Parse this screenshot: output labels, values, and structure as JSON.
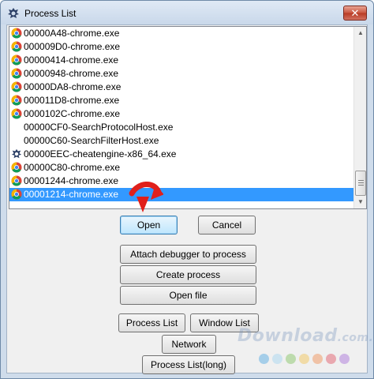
{
  "window": {
    "title": "Process List",
    "close_glyph": "✕",
    "app_icon": "cheatengine-icon"
  },
  "processes": [
    {
      "label": "00000A48-chrome.exe",
      "icon": "chrome-icon"
    },
    {
      "label": "000009D0-chrome.exe",
      "icon": "chrome-icon"
    },
    {
      "label": "00000414-chrome.exe",
      "icon": "chrome-icon"
    },
    {
      "label": "00000948-chrome.exe",
      "icon": "chrome-icon"
    },
    {
      "label": "00000DA8-chrome.exe",
      "icon": "chrome-icon"
    },
    {
      "label": "000011D8-chrome.exe",
      "icon": "chrome-icon"
    },
    {
      "label": "0000102C-chrome.exe",
      "icon": "chrome-icon"
    },
    {
      "label": "00000CF0-SearchProtocolHost.exe",
      "icon": ""
    },
    {
      "label": "00000C60-SearchFilterHost.exe",
      "icon": ""
    },
    {
      "label": "00000EEC-cheatengine-x86_64.exe",
      "icon": "cheatengine-icon"
    },
    {
      "label": "00000C80-chrome.exe",
      "icon": "chrome-icon"
    },
    {
      "label": "00001244-chrome.exe",
      "icon": "chrome-icon"
    },
    {
      "label": "00001214-chrome.exe",
      "icon": "chrome-icon",
      "selected": true
    }
  ],
  "buttons": {
    "open": "Open",
    "cancel": "Cancel",
    "attach": "Attach debugger to process",
    "create": "Create process",
    "open_file": "Open file",
    "process_list": "Process List",
    "window_list": "Window List",
    "network": "Network",
    "process_list_long": "Process List(long)"
  },
  "watermark": {
    "main": "Download",
    "suffix": ".com.vn"
  },
  "colors": {
    "selection": "#3399ff",
    "pointer_arrow": "#e0201b",
    "dots": [
      "#4aa3df",
      "#9fd3ef",
      "#7fc25a",
      "#f2c14e",
      "#f08a4b",
      "#e04f5f",
      "#a46bd6"
    ]
  }
}
